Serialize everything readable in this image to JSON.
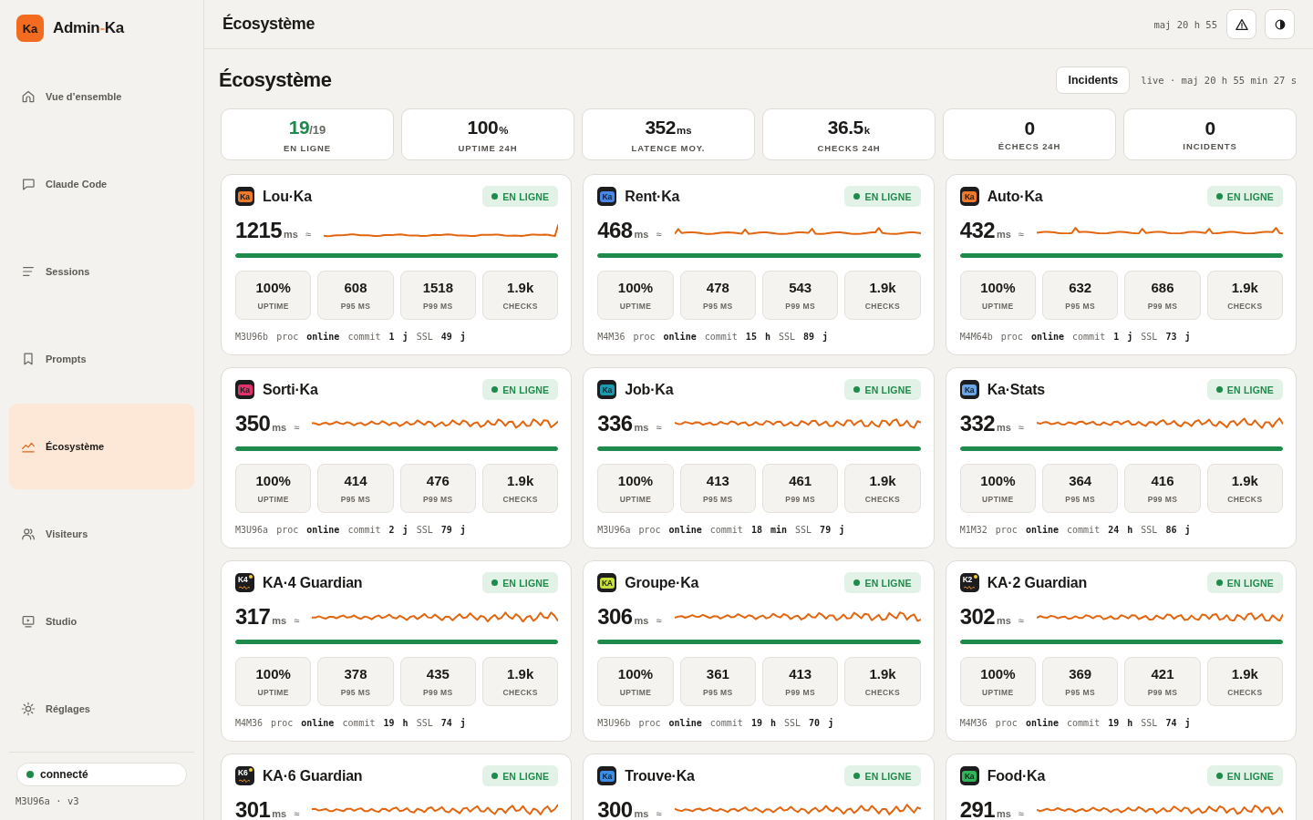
{
  "sidebar": {
    "brand": {
      "logo": "Ka",
      "name": "Admin",
      "separator": "-",
      "suffix": "Ka"
    },
    "items": [
      {
        "label": "Vue d’ensemble",
        "selected": false
      },
      {
        "label": "Claude Code",
        "selected": false
      },
      {
        "label": "Sessions",
        "selected": false
      },
      {
        "label": "Prompts",
        "selected": false
      },
      {
        "label": "Écosystème",
        "selected": true
      },
      {
        "label": "Visiteurs",
        "selected": false
      },
      {
        "label": "Studio",
        "selected": false
      },
      {
        "label": "Réglages",
        "selected": false
      }
    ],
    "connection": {
      "label": "connecté",
      "connected": true
    },
    "version": "M3U96a · v3"
  },
  "header": {
    "title": "Écosystème",
    "updated": "maj 20 h 55"
  },
  "page": {
    "title": "Écosystème",
    "incidents_button": "Incidents",
    "live_status": "live · maj 20 h 55 min 27 s"
  },
  "stats": [
    {
      "kind": "ratio",
      "value": "19",
      "unit": "/19",
      "label": "EN LIGNE"
    },
    {
      "kind": "metric",
      "value": "100",
      "unit": "%",
      "label": "UPTIME 24H"
    },
    {
      "kind": "metric",
      "value": "352",
      "unit": "ms",
      "label": "LATENCE MOY."
    },
    {
      "kind": "metric",
      "value": "36.5",
      "unit": "k",
      "label": "CHECKS 24H"
    },
    {
      "kind": "metric",
      "value": "0",
      "label": "ÉCHECS 24H"
    },
    {
      "kind": "metric",
      "value": "0",
      "label": "INCIDENTS"
    }
  ],
  "services": [
    {
      "name": "Lou·Ka",
      "logo": {
        "kind": "plain",
        "text": "Ka",
        "color": "#f07a2a"
      },
      "status": {
        "label": "EN LIGNE",
        "online": true
      },
      "latency": "1215",
      "unit": "ms",
      "approx": "≈",
      "sparkline": {
        "kind": "spike"
      },
      "uptime_bar": {
        "level": 1
      },
      "metrics": [
        {
          "value": "100%",
          "label": "UPTIME"
        },
        {
          "value": "608",
          "label": "P95 MS"
        },
        {
          "value": "1518",
          "label": "P99 MS"
        },
        {
          "value": "1.9k",
          "label": "CHECKS"
        }
      ],
      "footer": "M3U96b proc **online** commit **1 j** SSL **49 j**"
    },
    {
      "name": "Rent·Ka",
      "logo": {
        "kind": "plain",
        "text": "Ka",
        "color": "#4a86e8"
      },
      "status": {
        "label": "EN LIGNE",
        "online": true
      },
      "latency": "468",
      "unit": "ms",
      "approx": "≈",
      "sparkline": {
        "kind": "flat"
      },
      "uptime_bar": {
        "level": 1
      },
      "metrics": [
        {
          "value": "100%",
          "label": "UPTIME"
        },
        {
          "value": "478",
          "label": "P95 MS"
        },
        {
          "value": "543",
          "label": "P99 MS"
        },
        {
          "value": "1.9k",
          "label": "CHECKS"
        }
      ],
      "footer": "M4M36 proc **online** commit **15 h** SSL **89 j**"
    },
    {
      "name": "Auto·Ka",
      "logo": {
        "kind": "plain",
        "text": "Ka",
        "color": "#f07a2a"
      },
      "status": {
        "label": "EN LIGNE",
        "online": true
      },
      "latency": "432",
      "unit": "ms",
      "approx": "≈",
      "sparkline": {
        "kind": "flat"
      },
      "uptime_bar": {
        "level": 1
      },
      "metrics": [
        {
          "value": "100%",
          "label": "UPTIME"
        },
        {
          "value": "632",
          "label": "P95 MS"
        },
        {
          "value": "686",
          "label": "P99 MS"
        },
        {
          "value": "1.9k",
          "label": "CHECKS"
        }
      ],
      "footer": "M4M64b proc **online** commit **1 j** SSL **73 j**"
    },
    {
      "name": "Sorti·Ka",
      "logo": {
        "kind": "plain",
        "text": "Ka",
        "color": "#e0336b"
      },
      "status": {
        "label": "EN LIGNE",
        "online": true
      },
      "latency": "350",
      "unit": "ms",
      "approx": "≈",
      "sparkline": {
        "kind": "wave"
      },
      "uptime_bar": {
        "level": 1
      },
      "metrics": [
        {
          "value": "100%",
          "label": "UPTIME"
        },
        {
          "value": "414",
          "label": "P95 MS"
        },
        {
          "value": "476",
          "label": "P99 MS"
        },
        {
          "value": "1.9k",
          "label": "CHECKS"
        }
      ],
      "footer": "M3U96a proc **online** commit **2 j** SSL **79 j**"
    },
    {
      "name": "Job·Ka",
      "logo": {
        "kind": "plain",
        "text": "Ka",
        "color": "#1a9bb0"
      },
      "status": {
        "label": "EN LIGNE",
        "online": true
      },
      "latency": "336",
      "unit": "ms",
      "approx": "≈",
      "sparkline": {
        "kind": "wave"
      },
      "uptime_bar": {
        "level": 1
      },
      "metrics": [
        {
          "value": "100%",
          "label": "UPTIME"
        },
        {
          "value": "413",
          "label": "P95 MS"
        },
        {
          "value": "461",
          "label": "P99 MS"
        },
        {
          "value": "1.9k",
          "label": "CHECKS"
        }
      ],
      "footer": "M3U96a proc **online** commit **18 min** SSL **79 j**"
    },
    {
      "name": "Ka·Stats",
      "logo": {
        "kind": "plain",
        "text": "Ka",
        "color": "#6aa6e8"
      },
      "status": {
        "label": "EN LIGNE",
        "online": true
      },
      "latency": "332",
      "unit": "ms",
      "approx": "≈",
      "sparkline": {
        "kind": "wave"
      },
      "uptime_bar": {
        "level": 1
      },
      "metrics": [
        {
          "value": "100%",
          "label": "UPTIME"
        },
        {
          "value": "364",
          "label": "P95 MS"
        },
        {
          "value": "416",
          "label": "P99 MS"
        },
        {
          "value": "1.9k",
          "label": "CHECKS"
        }
      ],
      "footer": "M1M32 proc **online** commit **24 h** SSL **86 j**"
    },
    {
      "name": "KA·4 Guardian",
      "logo": {
        "kind": "guardian",
        "text": "K4"
      },
      "status": {
        "label": "EN LIGNE",
        "online": true
      },
      "latency": "317",
      "unit": "ms",
      "approx": "≈",
      "sparkline": {
        "kind": "wave"
      },
      "uptime_bar": {
        "level": 1
      },
      "metrics": [
        {
          "value": "100%",
          "label": "UPTIME"
        },
        {
          "value": "378",
          "label": "P95 MS"
        },
        {
          "value": "435",
          "label": "P99 MS"
        },
        {
          "value": "1.9k",
          "label": "CHECKS"
        }
      ],
      "footer": "M4M36 proc **online** commit **19 h** SSL **74 j**"
    },
    {
      "name": "Groupe·Ka",
      "logo": {
        "kind": "plain",
        "text": "KA",
        "color": "#c9e03a"
      },
      "status": {
        "label": "EN LIGNE",
        "online": true
      },
      "latency": "306",
      "unit": "ms",
      "approx": "≈",
      "sparkline": {
        "kind": "wave"
      },
      "uptime_bar": {
        "level": 1
      },
      "metrics": [
        {
          "value": "100%",
          "label": "UPTIME"
        },
        {
          "value": "361",
          "label": "P95 MS"
        },
        {
          "value": "413",
          "label": "P99 MS"
        },
        {
          "value": "1.9k",
          "label": "CHECKS"
        }
      ],
      "footer": "M3U96b proc **online** commit **19 h** SSL **70 j**"
    },
    {
      "name": "KA·2 Guardian",
      "logo": {
        "kind": "guardian",
        "text": "K2"
      },
      "status": {
        "label": "EN LIGNE",
        "online": true
      },
      "latency": "302",
      "unit": "ms",
      "approx": "≈",
      "sparkline": {
        "kind": "wave"
      },
      "uptime_bar": {
        "level": 1
      },
      "metrics": [
        {
          "value": "100%",
          "label": "UPTIME"
        },
        {
          "value": "369",
          "label": "P95 MS"
        },
        {
          "value": "421",
          "label": "P99 MS"
        },
        {
          "value": "1.9k",
          "label": "CHECKS"
        }
      ],
      "footer": "M4M36 proc **online** commit **19 h** SSL **74 j**"
    },
    {
      "name": "KA·6 Guardian",
      "logo": {
        "kind": "guardian",
        "text": "K6"
      },
      "status": {
        "label": "EN LIGNE",
        "online": true
      },
      "latency": "301",
      "unit": "ms",
      "approx": "≈",
      "sparkline": {
        "kind": "wave"
      }
    },
    {
      "name": "Trouve·Ka",
      "logo": {
        "kind": "plain",
        "text": "Ka",
        "color": "#3b8ee8"
      },
      "status": {
        "label": "EN LIGNE",
        "online": true
      },
      "latency": "300",
      "unit": "ms",
      "approx": "≈",
      "sparkline": {
        "kind": "wave"
      }
    },
    {
      "name": "Food·Ka",
      "logo": {
        "kind": "plain",
        "text": "Ka",
        "color": "#2fb55a"
      },
      "status": {
        "label": "EN LIGNE",
        "online": true
      },
      "latency": "291",
      "unit": "ms",
      "approx": "≈",
      "sparkline": {
        "kind": "wave"
      }
    }
  ]
}
